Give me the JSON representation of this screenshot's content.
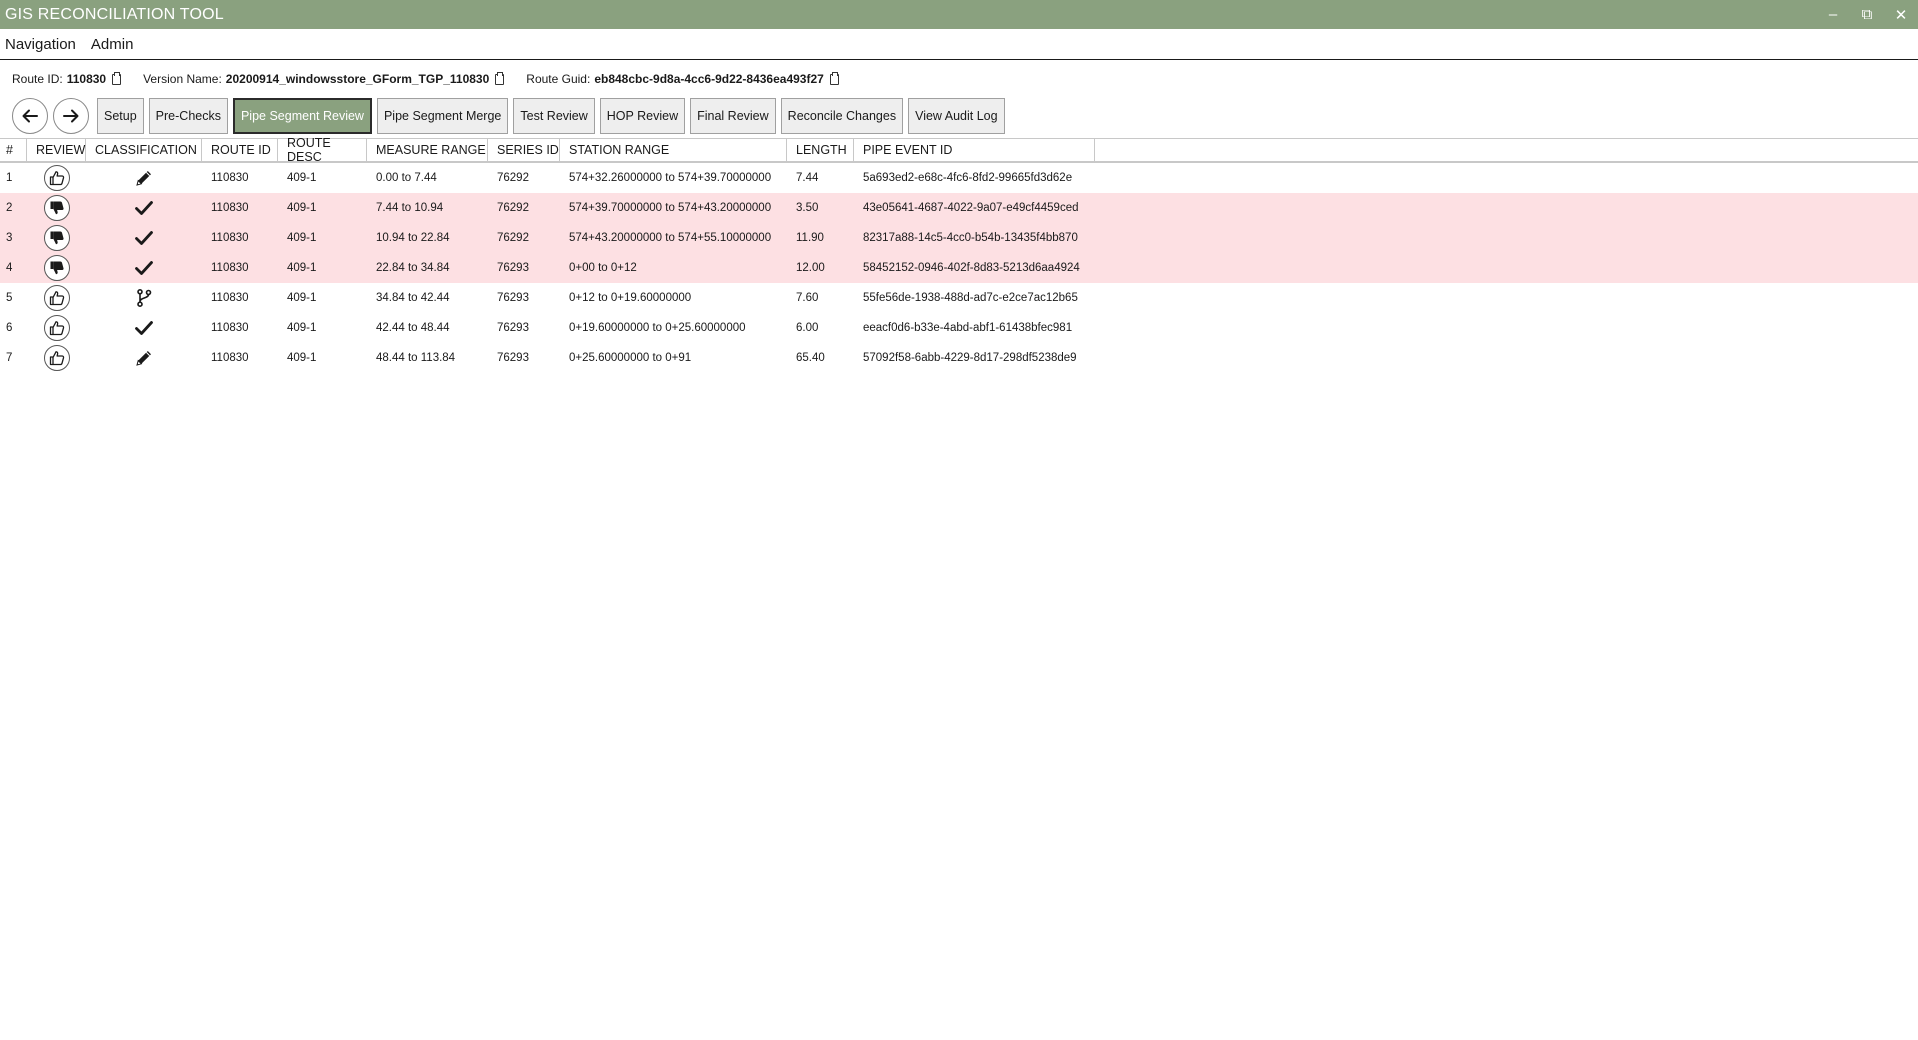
{
  "window": {
    "title": "GIS RECONCILIATION TOOL",
    "minimize": "–",
    "restore": "⧉",
    "close": "✕"
  },
  "menu": {
    "items": [
      {
        "label": "Navigation"
      },
      {
        "label": "Admin"
      }
    ]
  },
  "info": {
    "route_id_label": "Route ID:",
    "route_id_value": "110830",
    "version_label": "Version Name:",
    "version_value": "20200914_windowsstore_GForm_TGP_110830",
    "guid_label": "Route Guid:",
    "guid_value": "eb848cbc-9d8a-4cc6-9d22-8436ea493f27"
  },
  "toolbar": {
    "buttons": [
      {
        "label": "Setup",
        "active": false
      },
      {
        "label": "Pre-Checks",
        "active": false
      },
      {
        "label": "Pipe Segment Review",
        "active": true
      },
      {
        "label": "Pipe Segment Merge",
        "active": false
      },
      {
        "label": "Test Review",
        "active": false
      },
      {
        "label": "HOP Review",
        "active": false
      },
      {
        "label": "Final Review",
        "active": false
      },
      {
        "label": "Reconcile Changes",
        "active": false
      },
      {
        "label": "View Audit Log",
        "active": false
      }
    ]
  },
  "grid": {
    "columns": [
      "#",
      "REVIEW",
      "CLASSIFICATION",
      "ROUTE ID",
      "ROUTE DESC",
      "MEASURE RANGE",
      "SERIES ID",
      "STATION RANGE",
      "LENGTH",
      "PIPE EVENT ID"
    ],
    "rows": [
      {
        "num": "1",
        "review": "thumbs-up",
        "classification": "pencil",
        "route_id": "110830",
        "route_desc": "409-1",
        "measure": "0.00  to  7.44",
        "series": "76292",
        "station": "574+32.26000000  to  574+39.70000000",
        "length": "7.44",
        "pipe_event": "5a693ed2-e68c-4fc6-8fd2-99665fd3d62e"
      },
      {
        "num": "2",
        "review": "thumbs-down",
        "classification": "check",
        "route_id": "110830",
        "route_desc": "409-1",
        "measure": "7.44  to  10.94",
        "series": "76292",
        "station": "574+39.70000000  to  574+43.20000000",
        "length": "3.50",
        "pipe_event": "43e05641-4687-4022-9a07-e49cf4459ced"
      },
      {
        "num": "3",
        "review": "thumbs-down",
        "classification": "check",
        "route_id": "110830",
        "route_desc": "409-1",
        "measure": "10.94  to  22.84",
        "series": "76292",
        "station": "574+43.20000000  to  574+55.10000000",
        "length": "11.90",
        "pipe_event": "82317a88-14c5-4cc0-b54b-13435f4bb870"
      },
      {
        "num": "4",
        "review": "thumbs-down",
        "classification": "check",
        "route_id": "110830",
        "route_desc": "409-1",
        "measure": "22.84  to  34.84",
        "series": "76293",
        "station": "0+00  to  0+12",
        "length": "12.00",
        "pipe_event": "58452152-0946-402f-8d83-5213d6aa4924"
      },
      {
        "num": "5",
        "review": "thumbs-up",
        "classification": "branch",
        "route_id": "110830",
        "route_desc": "409-1",
        "measure": "34.84  to  42.44",
        "series": "76293",
        "station": "0+12  to  0+19.60000000",
        "length": "7.60",
        "pipe_event": "55fe56de-1938-488d-ad7c-e2ce7ac12b65"
      },
      {
        "num": "6",
        "review": "thumbs-up",
        "classification": "check",
        "route_id": "110830",
        "route_desc": "409-1",
        "measure": "42.44  to  48.44",
        "series": "76293",
        "station": "0+19.60000000  to  0+25.60000000",
        "length": "6.00",
        "pipe_event": "eeacf0d6-b33e-4abd-abf1-61438bfec981"
      },
      {
        "num": "7",
        "review": "thumbs-up",
        "classification": "pencil",
        "route_id": "110830",
        "route_desc": "409-1",
        "measure": "48.44  to  113.84",
        "series": "76293",
        "station": "0+25.60000000  to  0+91",
        "length": "65.40",
        "pipe_event": "57092f58-6abb-4229-8d17-298df5238de9"
      }
    ]
  },
  "colors": {
    "accent": "#8aa17f",
    "rejected_row": "#fde0e3"
  }
}
